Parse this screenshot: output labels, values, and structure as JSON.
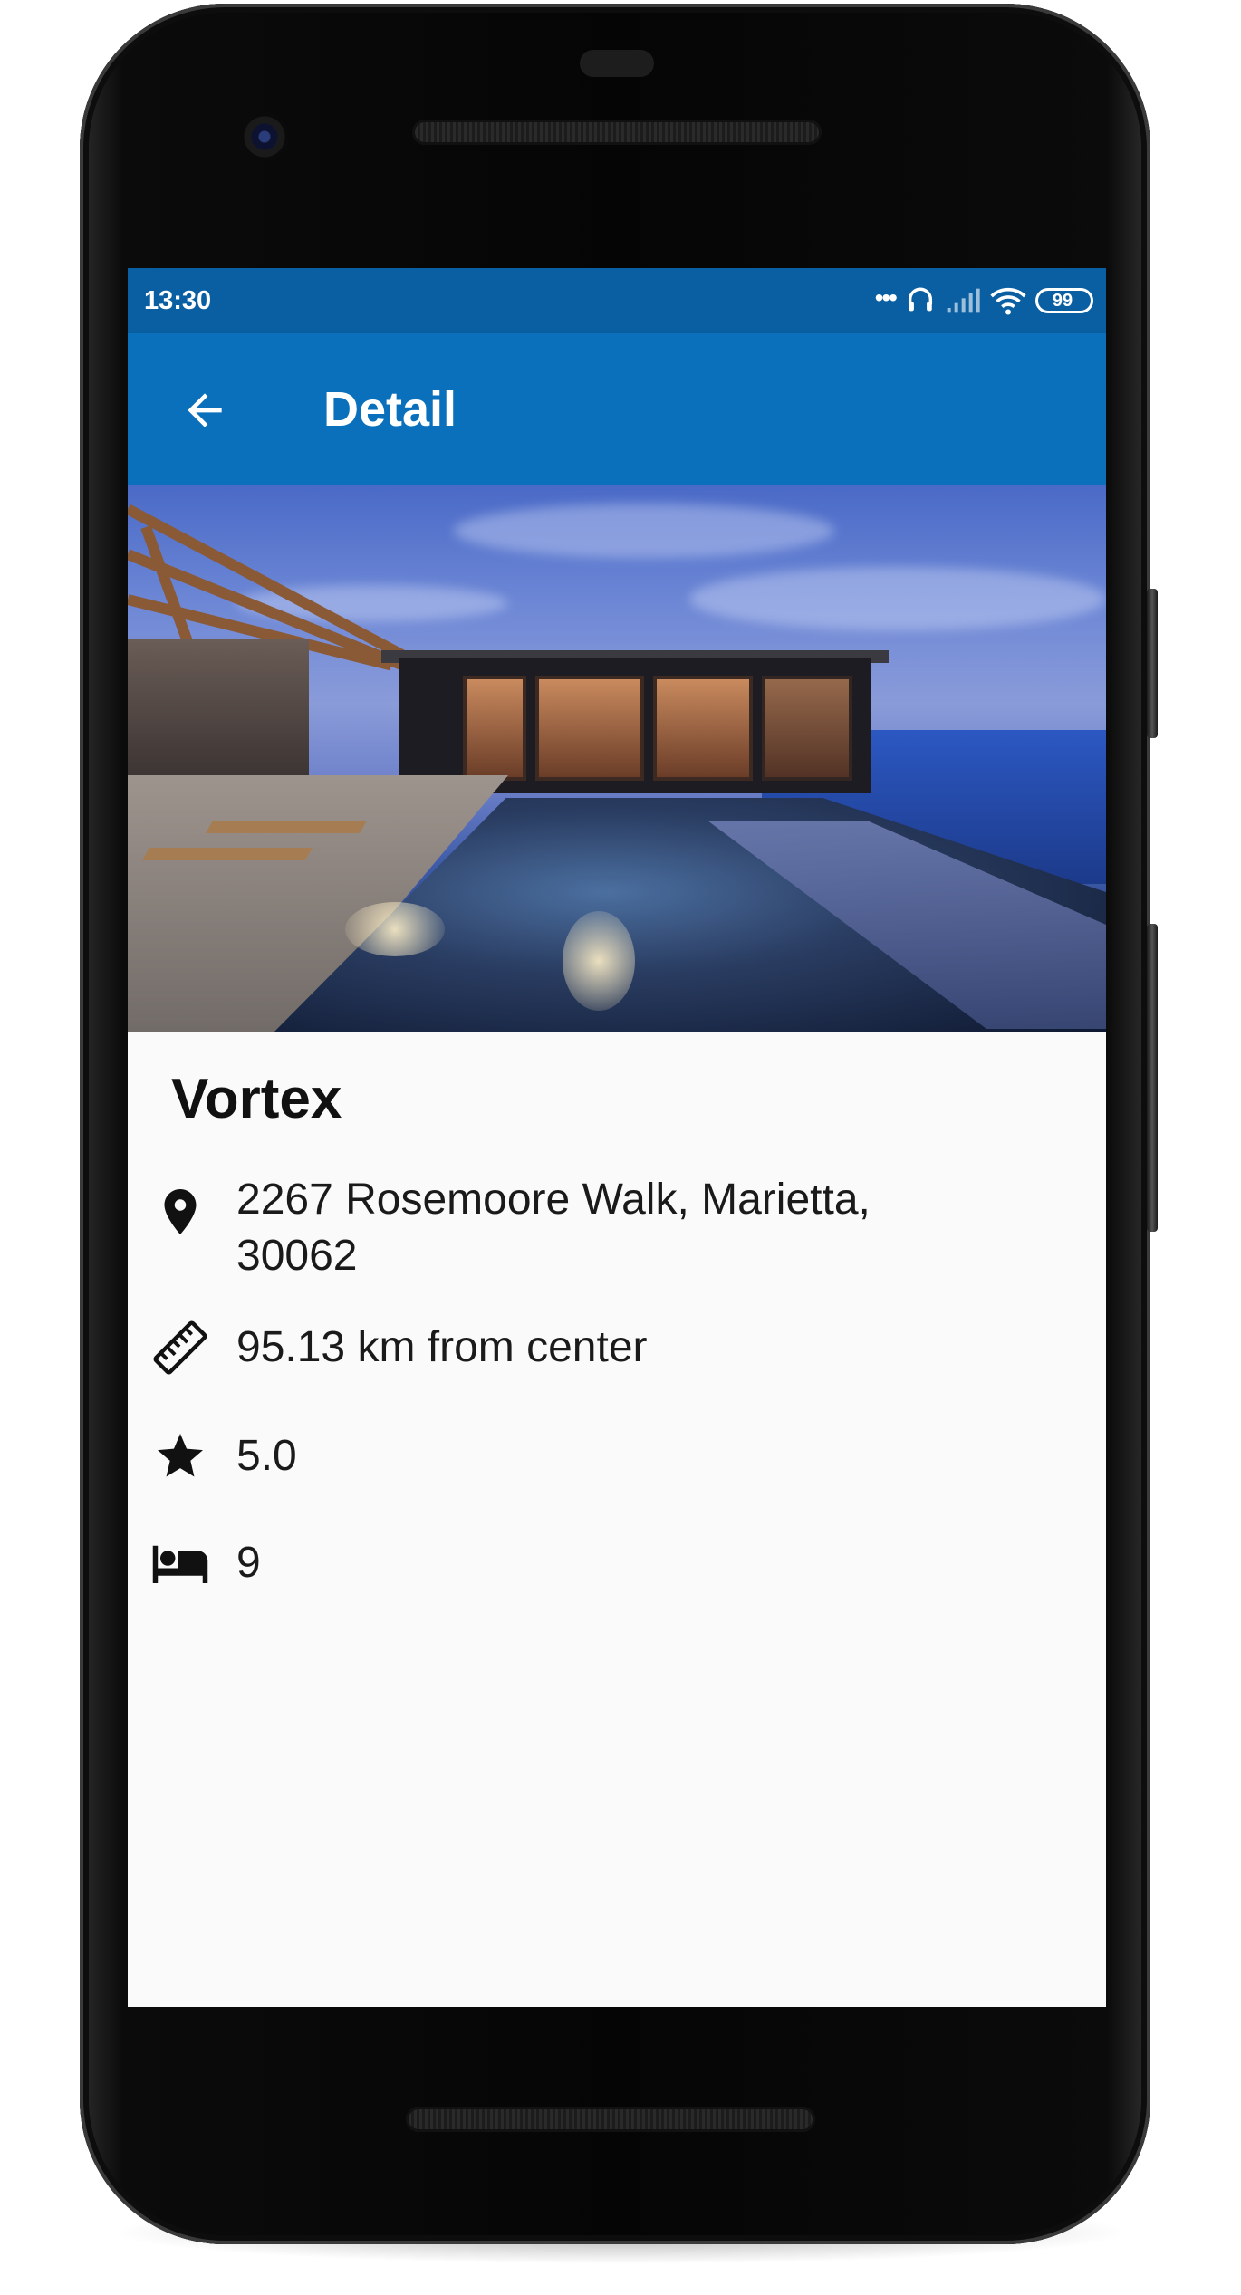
{
  "status_bar": {
    "time": "13:30",
    "battery": "99",
    "icons": [
      "more-dots-icon",
      "headset-icon",
      "signal-icon",
      "wifi-icon",
      "battery-icon"
    ]
  },
  "app_bar": {
    "title": "Detail",
    "back_icon": "arrow-left-icon"
  },
  "hero": {
    "image": "villa-infinity-pool-dusk"
  },
  "detail": {
    "name": "Vortex",
    "address_line1": "2267 Rosemoore Walk, Marietta,",
    "address_line2": "30062",
    "distance": "95.13 km from center",
    "rating": "5.0",
    "beds": "9"
  },
  "colors": {
    "status_bar": "#0a5fa3",
    "app_bar": "#0a70bb",
    "background": "#fafafa",
    "text": "#1a1a1a"
  }
}
